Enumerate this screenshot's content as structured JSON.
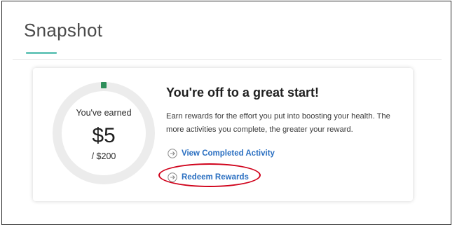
{
  "section": {
    "title": "Snapshot"
  },
  "progress": {
    "label": "You've earned",
    "amount": "$5",
    "total": "/ $200",
    "fraction": 0.025,
    "accent_color": "#2f8f5b",
    "track_color": "#ececec"
  },
  "message": {
    "headline": "You're off to a great start!",
    "body": "Earn rewards for the effort you put into boosting your health. The more activities you complete, the greater your reward."
  },
  "links": {
    "view_completed": {
      "label": "View Completed Activity",
      "icon": "circle-arrow-right-icon"
    },
    "redeem": {
      "label": "Redeem Rewards",
      "icon": "circle-arrow-right-icon"
    }
  },
  "colors": {
    "underline_accent": "#6cc7bb",
    "link": "#2a6fc1",
    "annotation": "#d0021b"
  }
}
